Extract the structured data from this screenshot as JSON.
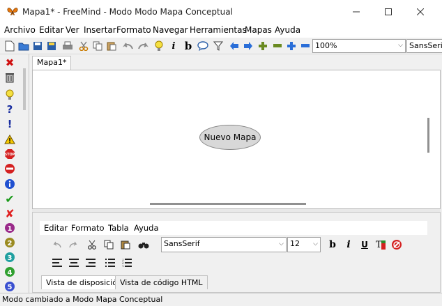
{
  "window": {
    "title": "Mapa1* - FreeMind - Modo Modo Mapa Conceptual"
  },
  "menubar": {
    "items": [
      "Archivo",
      "Editar",
      "Ver",
      "Insertar",
      "Formato",
      "Navegar",
      "Herramientas",
      "Mapas",
      "Ayuda"
    ]
  },
  "toolbar": {
    "icons": [
      "new-document-icon",
      "open-folder-icon",
      "save-icon",
      "save-as-icon",
      "print-icon",
      "cut-icon",
      "copy-icon",
      "paste-icon",
      "undo-icon",
      "redo-icon",
      "lightbulb-icon",
      "italic-icon",
      "bold-icon",
      "speech-bubble-icon",
      "filter-icon",
      "arrow-left-icon",
      "arrow-right-icon",
      "plus-icon",
      "minus-icon",
      "zoom-in-icon",
      "zoom-out-icon"
    ],
    "zoom_value": "100%",
    "font_value": "SansSerif"
  },
  "left_panel": {
    "icons": [
      "remove-icon",
      "trash-icon",
      "lightbulb-icon",
      "question-icon",
      "exclamation-icon",
      "warning-icon",
      "stop-icon",
      "no-entry-icon",
      "info-icon",
      "check-icon",
      "cross-icon",
      "priority-1-icon",
      "priority-2-icon",
      "priority-3-icon",
      "priority-4-icon",
      "priority-5-icon"
    ]
  },
  "tabs": {
    "map_tab": "Mapa1*"
  },
  "map": {
    "root_node": "Nuevo Mapa"
  },
  "editor": {
    "menu": [
      "Editar",
      "Formato",
      "Tabla",
      "Ayuda"
    ],
    "font_value": "SansSerif",
    "size_value": "12",
    "tabs": [
      "Vista de disposición",
      "Vista de código HTML"
    ]
  },
  "status": {
    "text": "Modo cambiado a Modo Mapa Conceptual"
  }
}
